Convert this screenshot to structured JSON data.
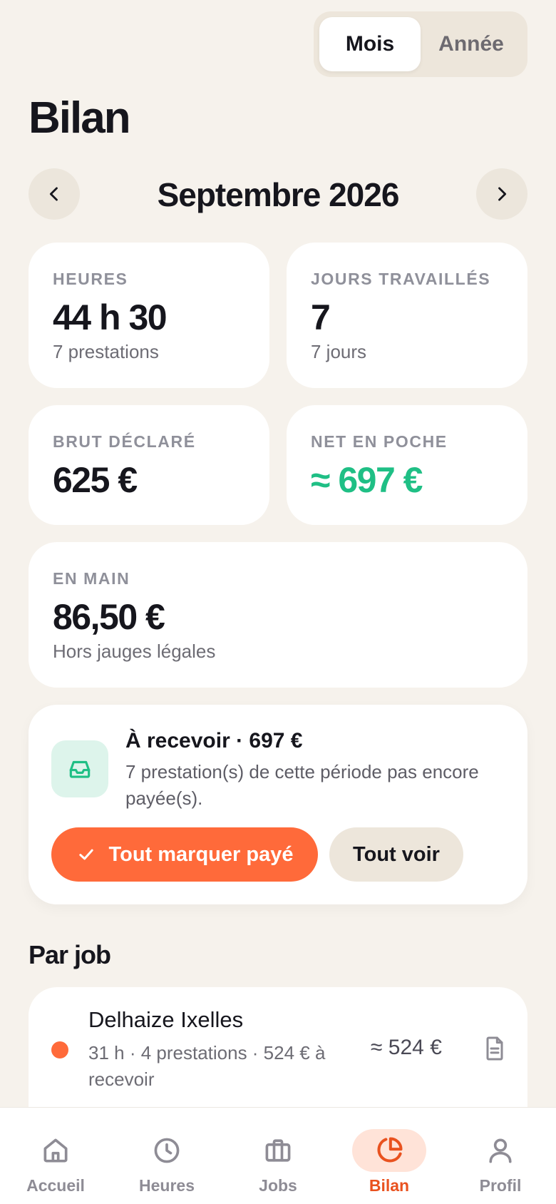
{
  "toggle": {
    "month_label": "Mois",
    "year_label": "Année",
    "selected": "Mois"
  },
  "page": {
    "title": "Bilan"
  },
  "period": {
    "label": "Septembre 2026",
    "prev_icon": "chevron-left-icon",
    "next_icon": "chevron-right-icon"
  },
  "stats": {
    "hours": {
      "label": "HEURES",
      "value": "44 h 30",
      "sub": "7 prestations"
    },
    "days": {
      "label": "JOURS TRAVAILLÉS",
      "value": "7",
      "sub": "7 jours"
    },
    "gross": {
      "label": "BRUT DÉCLARÉ",
      "value": "625 €"
    },
    "net": {
      "label": "NET EN POCHE",
      "value": "≈ 697 €"
    },
    "cash": {
      "label": "EN MAIN",
      "value": "86,50 €",
      "sub": "Hors jauges légales"
    }
  },
  "receive": {
    "icon": "inbox-icon",
    "title": "À recevoir · 697 €",
    "description": "7 prestation(s) de cette période pas encore payée(s).",
    "pay_all_label": "Tout marquer payé",
    "see_all_label": "Tout voir"
  },
  "by_job": {
    "title": "Par job",
    "jobs": [
      {
        "name": "Delhaize Ixelles",
        "meta": "31 h · 4 prestations · 524 € à recevoir",
        "amount": "≈ 524 €",
        "color": "#FF6A3A"
      }
    ]
  },
  "bottom_nav": [
    {
      "label": "Accueil",
      "icon": "home-icon"
    },
    {
      "label": "Heures",
      "icon": "clock-icon"
    },
    {
      "label": "Jobs",
      "icon": "briefcase-icon"
    },
    {
      "label": "Bilan",
      "icon": "pie-chart-icon",
      "active": true
    },
    {
      "label": "Profil",
      "icon": "user-icon"
    }
  ],
  "colors": {
    "accent": "#FF6A3A",
    "positive": "#1FBF85",
    "background": "#F6F2EC"
  }
}
